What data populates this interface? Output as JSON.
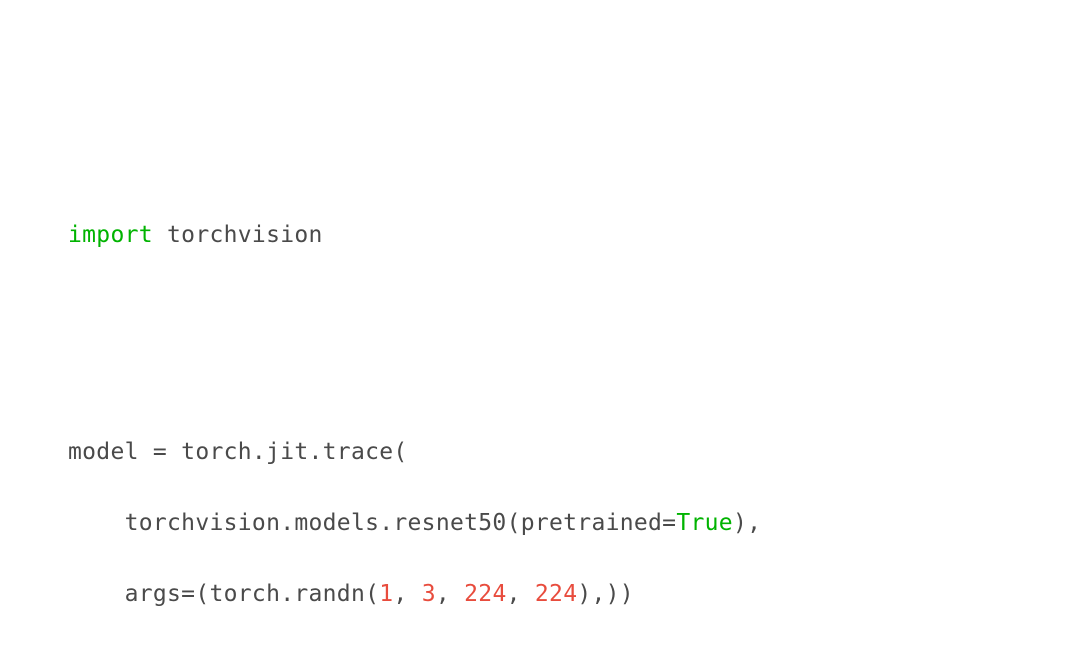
{
  "code": {
    "line1": {
      "kw": "import",
      "rest": " torchvision"
    },
    "line2": {
      "text": "model = torch.jit.trace("
    },
    "line3": {
      "indent": "    ",
      "part1": "torchvision.models.resnet50(pretrained=",
      "true": "True",
      "part2": "),"
    },
    "line4": {
      "indent": "    ",
      "part1": "args=(torch.randn(",
      "n1": "1",
      "c1": ", ",
      "n2": "3",
      "c2": ", ",
      "n3": "224",
      "c3": ", ",
      "n4": "224",
      "part2": "),))"
    }
  }
}
